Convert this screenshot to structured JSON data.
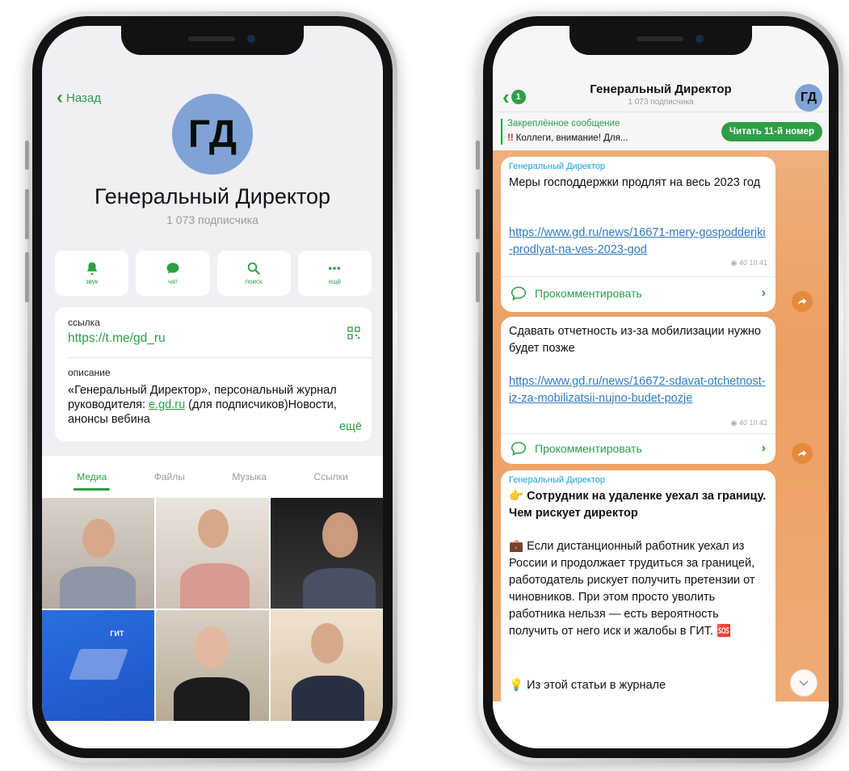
{
  "left_phone": {
    "back_label": "Назад",
    "avatar_initials": "ГД",
    "channel_name": "Генеральный Директор",
    "subscribers": "1 073 подписчика",
    "actions": [
      {
        "label": "звук",
        "icon": "bell-icon"
      },
      {
        "label": "чат",
        "icon": "chat-bubble-icon"
      },
      {
        "label": "поиск",
        "icon": "search-icon"
      },
      {
        "label": "ещё",
        "icon": "more-icon"
      }
    ],
    "link_label": "ссылка",
    "link_value": "https://t.me/gd_ru",
    "description_label": "описание",
    "description_part1": "«Генеральный Директор», персональный журнал руководителя: ",
    "description_link": "e.gd.ru",
    "description_part2": " (для подписчиков)Новости, анонсы вебина",
    "more_label": "ещё",
    "tabs": [
      "Медиа",
      "Файлы",
      "Музыка",
      "Ссылки"
    ],
    "active_tab": "Медиа",
    "media_tile_text": "ГИТ"
  },
  "right_phone": {
    "unread_count": "1",
    "channel_name": "Генеральный Директор",
    "subscribers": "1 073 подписчика",
    "avatar_initials": "ГД",
    "pinned_title": "Закреплённое сообщение",
    "pinned_marker": "!!",
    "pinned_text": "Коллеги, внимание! Для...",
    "pinned_button": "Читать 11-й номер",
    "messages": [
      {
        "sender": "Генеральный Директор",
        "text": "Меры господдержки продлят на весь 2023 год",
        "link": "https://www.gd.ru/news/16671-mery-gospodderjki-prodlyat-na-ves-2023-god",
        "meta": "◉ 40 10:41",
        "comment_label": "Прокомментировать"
      },
      {
        "text": "Сдавать отчетность из-за мобилизации нужно будет позже",
        "link": "https://www.gd.ru/news/16672-sdavat-otchetnost-iz-za-mobilizatsii-nujno-budet-pozje",
        "meta": "◉ 40 10:42",
        "comment_label": "Прокомментировать"
      },
      {
        "sender": "Генеральный Директор",
        "headline": "👉 Сотрудник на удаленке уехал за границу. Чем рискует директор",
        "body": "💼 Если дистанционный работник уехал из России и продолжает трудиться за границей, работодатель рискует получить претензии от чиновников. При этом просто уволить работника нельзя — есть вероятность получить от него иск и жалобы в ГИТ. 🆘",
        "footer": "💡 Из этой статьи в журнале"
      }
    ]
  },
  "colors": {
    "accent_green": "#2e9e45",
    "avatar_blue": "#7ea3d4",
    "chat_bg_orange": "#ec9f62",
    "link_blue": "#2f7bc4",
    "sender_blue": "#1d9fd9"
  }
}
